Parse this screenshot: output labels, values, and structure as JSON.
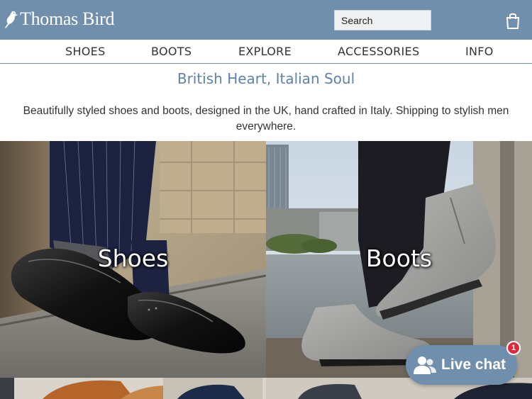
{
  "brand": {
    "name": "Thomas Bird",
    "logo_icon": "bird-icon"
  },
  "header": {
    "search": {
      "placeholder": "Search"
    },
    "cart_icon": "shopping-bag-icon",
    "accent_color": "#6f8fac"
  },
  "nav": {
    "items": [
      {
        "label": "SHOES"
      },
      {
        "label": "BOOTS"
      },
      {
        "label": "EXPLORE"
      },
      {
        "label": "ACCESSORIES"
      },
      {
        "label": "INFO"
      }
    ]
  },
  "hero": {
    "tagline": "British Heart, Italian Soul",
    "intro": "Beautifully styled shoes and boots, designed in the UK, hand crafted in Italy. Shipping to stylish men everywhere."
  },
  "categories": [
    {
      "label": "Shoes"
    },
    {
      "label": "Boots"
    }
  ],
  "chat": {
    "label": "Live chat",
    "unread_count": "1",
    "icon": "chat-people-icon",
    "badge_color": "#e0283c"
  }
}
